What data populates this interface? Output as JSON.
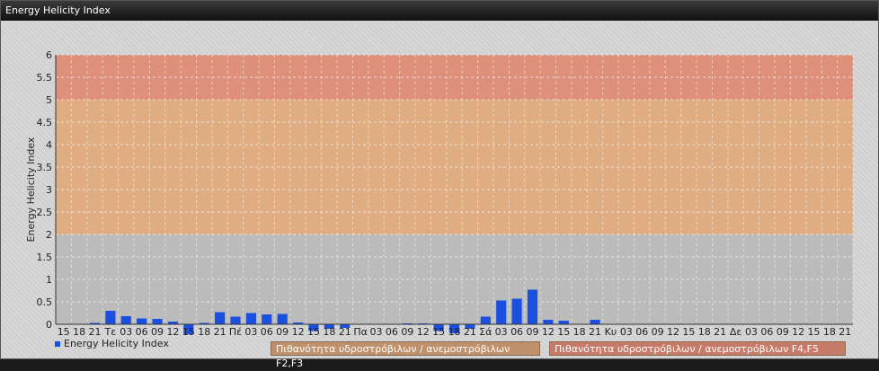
{
  "window": {
    "title": "Energy Helicity Index"
  },
  "legend": {
    "series_label": "Energy Helicity Index",
    "badge1": "Πιθανότητα υδροστρόβιλων / ανεμοστρόβιλων F2,F3",
    "badge2": "Πιθανότητα υδροστρόβιλων / ανεμοστρόβιλων F4,F5"
  },
  "colors": {
    "bar": "#1a4fe0",
    "band_low": "#b8b8b8",
    "band_mid": "#e0a878",
    "band_high": "#e08870",
    "badge1": "#c0906a",
    "badge2": "#c87a68"
  },
  "chart_data": {
    "type": "bar",
    "ylabel": "Energy Helicity Index",
    "ylim": [
      0,
      6
    ],
    "yticks": [
      "0",
      "0.5",
      "1",
      "1.5",
      "2",
      "2.5",
      "3",
      "3.5",
      "4",
      "4.5",
      "5",
      "5.5",
      "6"
    ],
    "bands": [
      {
        "from": 0,
        "to": 2
      },
      {
        "from": 2,
        "to": 5
      },
      {
        "from": 5,
        "to": 6
      }
    ],
    "categories": [
      "15",
      "18",
      "21",
      "Τε",
      "03",
      "06",
      "09",
      "12",
      "15",
      "18",
      "21",
      "Πέ",
      "03",
      "06",
      "09",
      "12",
      "15",
      "18",
      "21",
      "Πα",
      "03",
      "06",
      "09",
      "12",
      "15",
      "18",
      "21",
      "Σά",
      "03",
      "06",
      "09",
      "12",
      "15",
      "18",
      "21",
      "Κυ",
      "03",
      "06",
      "09",
      "12",
      "15",
      "18",
      "21",
      "Δε",
      "03",
      "06",
      "09",
      "12",
      "15",
      "18",
      "21"
    ],
    "series": [
      {
        "values": [
          0.01,
          0.01,
          0.03,
          0.3,
          0.18,
          0.13,
          0.12,
          0.06,
          -0.22,
          0.03,
          0.27,
          0.17,
          0.25,
          0.22,
          0.23,
          0.04,
          -0.15,
          -0.1,
          -0.08,
          0.01,
          0.01,
          0.01,
          0.02,
          0.02,
          -0.15,
          -0.2,
          -0.1,
          0.17,
          0.53,
          0.57,
          0.77,
          0.1,
          0.08,
          0.01,
          0.1,
          0.01,
          0.01,
          0.01,
          0.01,
          0.01,
          0.01,
          0.01,
          0.01,
          0.01,
          0.01,
          0.01,
          0.01,
          0.01,
          0.01,
          0.01,
          0.01
        ]
      }
    ]
  }
}
